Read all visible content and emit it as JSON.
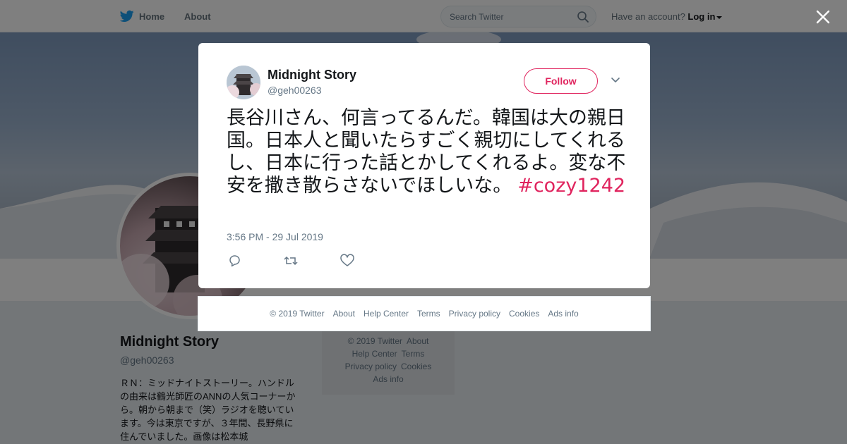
{
  "topbar": {
    "home_label": "Home",
    "about_label": "About",
    "search_placeholder": "Search Twitter",
    "account_prompt": "Have an account?",
    "login_label": "Log in"
  },
  "profile": {
    "name": "Midnight Story",
    "handle": "@geh00263",
    "bio": "ＲＮ：ミッドナイトストーリー。ハンドルの由来は鶴光師匠のANNの人気コーナーから。朝から朝まで（笑）ラジオを聴いています。今は東京ですが、３年間、長野県に住んでいました。画像は松本城"
  },
  "side_footer": {
    "line1": [
      "© 2019 Twitter",
      "About"
    ],
    "line2": [
      "Help Center",
      "Terms"
    ],
    "line3": [
      "Privacy policy",
      "Cookies"
    ],
    "line4": [
      "Ads info"
    ]
  },
  "tweet": {
    "author_name": "Midnight Story",
    "author_handle": "@geh00263",
    "follow_label": "Follow",
    "text": "長谷川さん、何言ってるんだ。韓国は大の親日国。日本人と聞いたらすごく親切にしてくれるし、日本に行った話とかしてくれるよ。変な不安を撒き散らさないでほしいな。",
    "hashtag": "#cozy1242",
    "timestamp": "3:56 PM - 29 Jul 2019"
  },
  "footer": {
    "links": [
      "© 2019 Twitter",
      "About",
      "Help Center",
      "Terms",
      "Privacy policy",
      "Cookies",
      "Ads info"
    ]
  },
  "icons": {
    "brand": "twitter-bird-icon",
    "search": "search-icon",
    "close": "close-icon",
    "menu": "chevron-down-icon",
    "reply": "reply-icon",
    "retweet": "retweet-icon",
    "like": "heart-icon"
  },
  "colors": {
    "brand_blue": "#1da1f2",
    "accent_pink": "#e0245e",
    "muted_text": "#657786"
  }
}
